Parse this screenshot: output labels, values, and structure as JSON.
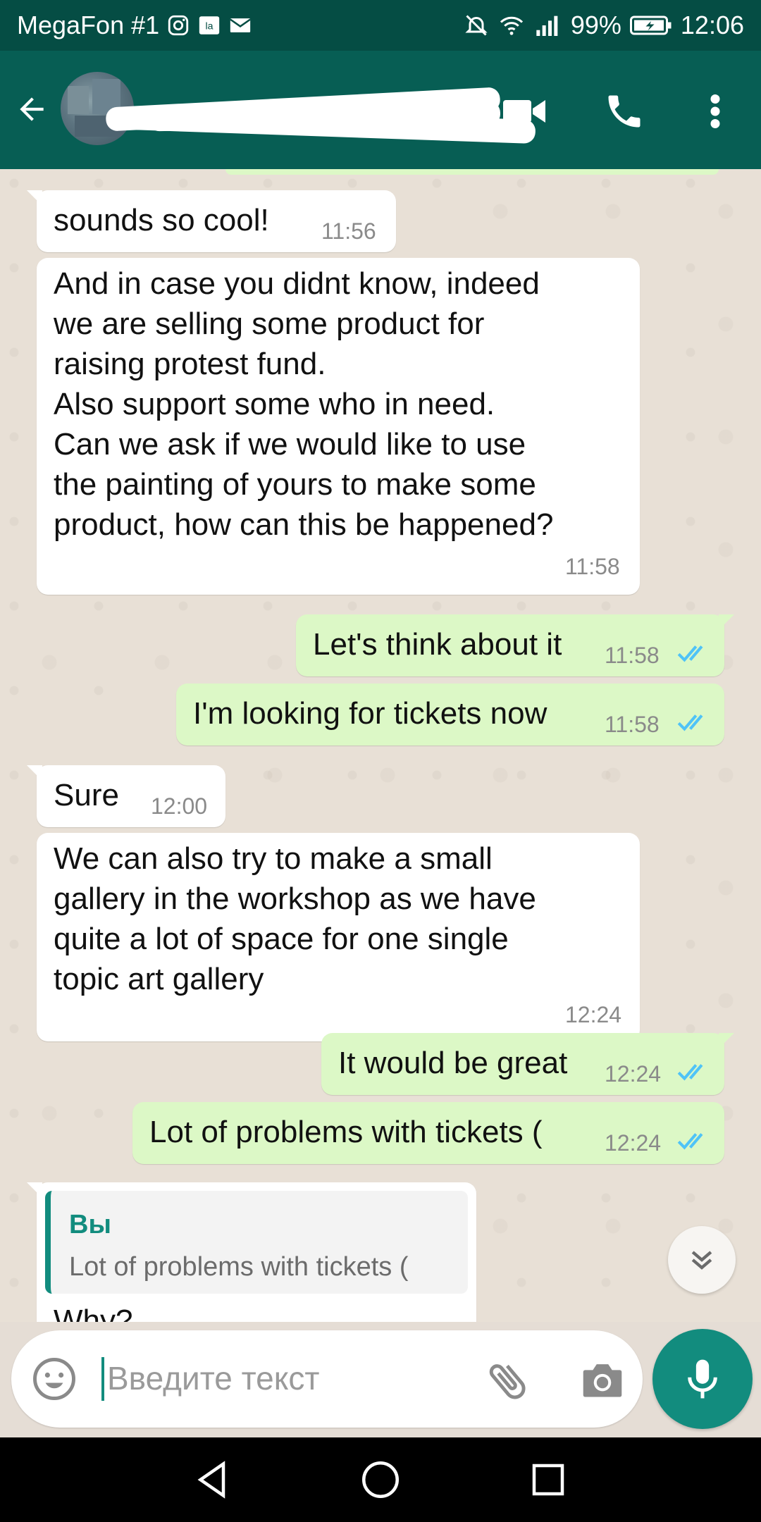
{
  "status_bar": {
    "carrier": "MegaFon #1",
    "battery": "99%",
    "time": "12:06"
  },
  "chat": {
    "messages": [
      {
        "direction": "in",
        "text": "sounds so cool!",
        "time": "11:56"
      },
      {
        "direction": "in",
        "text": "And in case you didnt know, indeed\nwe are selling some product for\nraising protest fund.\nAlso support some who in need.\nCan we ask if we would like to use\nthe painting of yours to make some\nproduct, how can this be happened?",
        "time": "11:58"
      },
      {
        "direction": "out",
        "text": "Let's think about it",
        "time": "11:58",
        "status": "read"
      },
      {
        "direction": "out",
        "text": "I'm looking for tickets now",
        "time": "11:58",
        "status": "read"
      },
      {
        "direction": "in",
        "text": "Sure",
        "time": "12:00"
      },
      {
        "direction": "in",
        "text": "We can also try to make a small\ngallery in the workshop as we have\nquite a lot of space for one single\ntopic art gallery",
        "time": "12:24"
      },
      {
        "direction": "out",
        "text": "It would be great",
        "time": "12:24",
        "status": "read"
      },
      {
        "direction": "out",
        "text": "Lot of problems with tickets (",
        "time": "12:24",
        "status": "read"
      },
      {
        "direction": "in",
        "reply_to": {
          "author": "Вы",
          "text": "Lot of problems with tickets ("
        },
        "text": "Why?"
      }
    ]
  },
  "input": {
    "placeholder": "Введите текст",
    "value": ""
  },
  "colors": {
    "header": "#075e54",
    "status_bar": "#054d44",
    "accent": "#128c7e",
    "outgoing_bubble": "#dcf8c6",
    "incoming_bubble": "#ffffff",
    "read_ticks": "#4fc3f7"
  },
  "icons": {
    "back": "arrow-left-icon",
    "video": "video-camera-icon",
    "call": "phone-icon",
    "more": "more-vert-icon",
    "scroll": "double-chevron-down-icon",
    "emoji": "smiley-icon",
    "attach": "paperclip-icon",
    "camera": "camera-icon",
    "mic": "microphone-icon"
  }
}
